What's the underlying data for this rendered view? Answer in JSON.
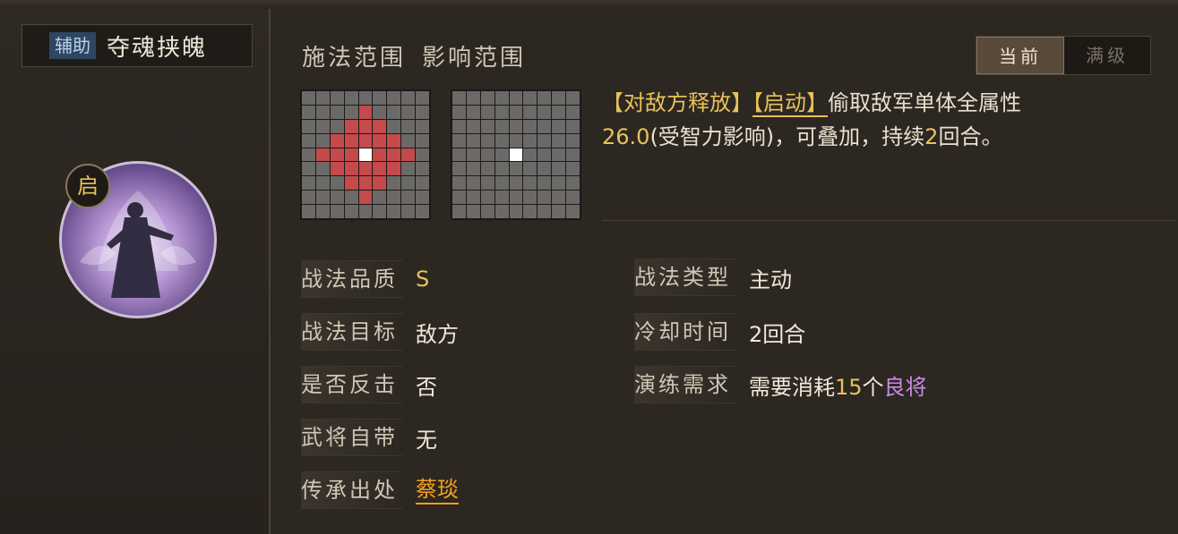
{
  "skill": {
    "tag": "辅助",
    "name": "夺魂挟魄",
    "badge": "启"
  },
  "range_labels": {
    "cast": "施法范围",
    "effect": "影响范围"
  },
  "toggle": {
    "current": "当前",
    "max": "满级"
  },
  "description": {
    "target_tag": "【对敌方释放】",
    "type_tag": "【启动】",
    "text1": "偷取敌军单体全属性",
    "value": "26.0",
    "text2": "(受智力影响)，可叠加，持续",
    "rounds": "2",
    "text3": "回合。"
  },
  "attributes": {
    "quality_label": "战法品质",
    "quality": "S",
    "target_label": "战法目标",
    "target": "敌方",
    "counter_label": "是否反击",
    "counter": "否",
    "innate_label": "武将自带",
    "innate": "无",
    "source_label": "传承出处",
    "source": "蔡琰",
    "type_label": "战法类型",
    "type": "主动",
    "cooldown_label": "冷却时间",
    "cooldown": "2回合",
    "drill_label": "演练需求",
    "drill_pre": "需要消耗",
    "drill_num": "15",
    "drill_mid": "个",
    "drill_item": "良将"
  },
  "colors": {
    "accent": "#e8c25a",
    "range_red": "#c44a4c",
    "purple": "#c88ae8",
    "orange": "#f0a020"
  }
}
